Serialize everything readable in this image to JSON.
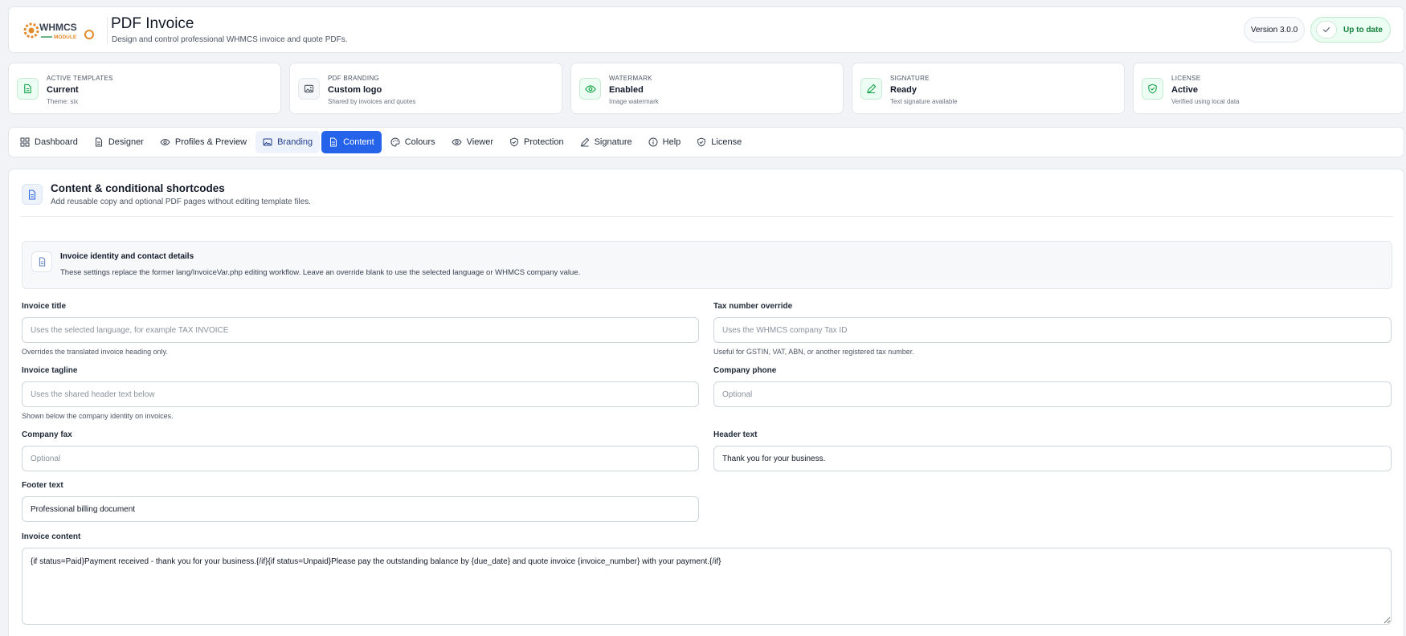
{
  "header": {
    "logo_text": "WHMCS MODULE",
    "title": "PDF Invoice",
    "subtitle": "Design and control professional WHMCS invoice and quote PDFs.",
    "version": "Version 3.0.0",
    "status": "Up to date"
  },
  "colors": {
    "accent": "#2563eb",
    "success": "#16a34a",
    "success_bg": "#ecfdf3"
  },
  "summary_cards": [
    {
      "icon": "document-icon",
      "kicker": "Active templates",
      "value": "Current",
      "sub": "Theme: six"
    },
    {
      "icon": "image-icon",
      "kicker": "PDF Branding",
      "value": "Custom logo",
      "sub": "Shared by invoices and quotes"
    },
    {
      "icon": "eye-icon",
      "kicker": "Watermark",
      "value": "Enabled",
      "sub": "Image watermark"
    },
    {
      "icon": "pen-icon",
      "kicker": "Signature",
      "value": "Ready",
      "sub": "Text signature available"
    },
    {
      "icon": "shield-check-icon",
      "kicker": "License",
      "value": "Active",
      "sub": "Verified using local data"
    }
  ],
  "tabs": [
    {
      "label": "Dashboard",
      "icon": "grid-icon",
      "state": "normal"
    },
    {
      "label": "Designer",
      "icon": "document-icon",
      "state": "normal"
    },
    {
      "label": "Profiles & Preview",
      "icon": "eye-icon",
      "state": "normal"
    },
    {
      "label": "Branding",
      "icon": "image-icon",
      "state": "hover"
    },
    {
      "label": "Content",
      "icon": "document-icon",
      "state": "active"
    },
    {
      "label": "Colours",
      "icon": "palette-icon",
      "state": "normal"
    },
    {
      "label": "Viewer",
      "icon": "eye-icon",
      "state": "normal"
    },
    {
      "label": "Protection",
      "icon": "shield-check-icon",
      "state": "normal"
    },
    {
      "label": "Signature",
      "icon": "pen-icon",
      "state": "normal"
    },
    {
      "label": "Help",
      "icon": "info-icon",
      "state": "normal"
    },
    {
      "label": "License",
      "icon": "shield-check-icon",
      "state": "normal"
    }
  ],
  "section": {
    "title": "Content & conditional shortcodes",
    "subtitle": "Add reusable copy and optional PDF pages without editing template files."
  },
  "notice": {
    "title": "Invoice identity and contact details",
    "text": "These settings replace the former lang/InvoiceVar.php editing workflow. Leave an override blank to use the selected language or WHMCS company value."
  },
  "fields": {
    "invoice_title": {
      "label": "Invoice title",
      "value": "",
      "placeholder": "Uses the selected language, for example TAX INVOICE",
      "help": "Overrides the translated invoice heading only."
    },
    "tax_number": {
      "label": "Tax number override",
      "value": "",
      "placeholder": "Uses the WHMCS company Tax ID",
      "help": "Useful for GSTIN, VAT, ABN, or another registered tax number."
    },
    "invoice_tagline": {
      "label": "Invoice tagline",
      "value": "",
      "placeholder": "Uses the shared header text below",
      "help": "Shown below the company identity on invoices."
    },
    "company_phone": {
      "label": "Company phone",
      "value": "",
      "placeholder": "Optional"
    },
    "company_fax": {
      "label": "Company fax",
      "value": "",
      "placeholder": "Optional"
    },
    "header_text": {
      "label": "Header text",
      "value": "Thank you for your business.",
      "placeholder": ""
    },
    "footer_text": {
      "label": "Footer text",
      "value": "Professional billing document",
      "placeholder": ""
    },
    "invoice_content": {
      "label": "Invoice content",
      "value": "{if status=Paid}Payment received - thank you for your business.{/if}{if status=Unpaid}Please pay the outstanding balance by {due_date} and quote invoice {invoice_number} with your payment.{/if}"
    }
  }
}
